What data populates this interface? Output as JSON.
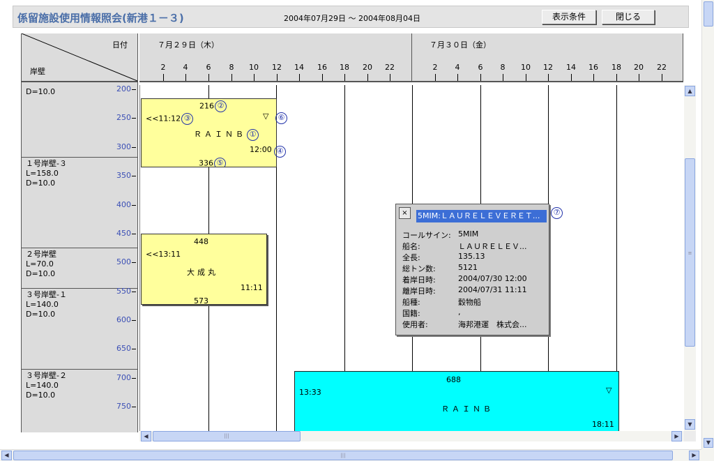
{
  "header": {
    "title": "係留施設使用情報照会(新港１－３)",
    "date_range": "2004年07月29日 ～ 2004年08月04日",
    "display_conditions_button": "表示条件",
    "close_button": "閉じる"
  },
  "corner": {
    "date_label": "日付",
    "quay_label": "岸壁"
  },
  "days": [
    {
      "label": "７月２９日（木）"
    },
    {
      "label": "７月３０日（金）"
    }
  ],
  "hours": [
    "2",
    "4",
    "6",
    "8",
    "10",
    "12",
    "14",
    "16",
    "18",
    "20",
    "22"
  ],
  "quays": [
    {
      "partial_top": "D=10.0"
    },
    {
      "name": "１号岸壁-３",
      "length": "L=158.0",
      "depth": "D=10.0"
    },
    {
      "name": "２号岸壁",
      "length": "L=70.0",
      "depth": "D=10.0"
    },
    {
      "name": "３号岸壁-１",
      "length": "L=140.0",
      "depth": "D=10.0"
    },
    {
      "name": "３号岸壁-２",
      "length": "L=140.0",
      "depth": "D=10.0"
    }
  ],
  "ticks": [
    "200",
    "250",
    "300",
    "350",
    "400",
    "450",
    "500",
    "550",
    "600",
    "650",
    "700",
    "750"
  ],
  "blocks": {
    "rainb1": {
      "top_pos": "216",
      "top_marker": "②",
      "arrival": "<<11:12",
      "arrival_marker": "③",
      "flag": "▽",
      "flag_marker": "⑥",
      "name": "ＲＡＩＮＢ",
      "name_marker": "①",
      "departure": "12:00",
      "departure_marker": "④",
      "bottom_pos": "336",
      "bottom_marker": "⑤",
      "color": "#ffff9c"
    },
    "taisei": {
      "top_pos": "448",
      "arrival": "<<13:11",
      "name": "大成丸",
      "departure": "11:11",
      "bottom_pos": "573",
      "color": "#ffff9c"
    },
    "rainb2": {
      "top_pos": "688",
      "arrival": "13:33",
      "flag": "▽",
      "name": "ＲＡＩＮＢ",
      "departure": "18:11",
      "color": "#00ffff"
    }
  },
  "popup": {
    "close": "×",
    "title": "5MIM:ＬＡＵＲＥＬＥＶＥＲＥＴ...",
    "marker": "⑦",
    "rows": [
      {
        "label": "コールサイン:",
        "value": "5MIM"
      },
      {
        "label": "船名:",
        "value": "ＬＡＵＲＥＬＥＶ..."
      },
      {
        "label": "全長:",
        "value": "135.13"
      },
      {
        "label": "総トン数:",
        "value": "5121"
      },
      {
        "label": "着岸日時:",
        "value": "2004/07/30 12:00"
      },
      {
        "label": "離岸日時:",
        "value": "2004/07/31 11:11"
      },
      {
        "label": "船種:",
        "value": "穀物船"
      },
      {
        "label": "国籍:",
        "value": ","
      },
      {
        "label": "使用者:",
        "value": "海邦港運　株式会..."
      }
    ]
  }
}
